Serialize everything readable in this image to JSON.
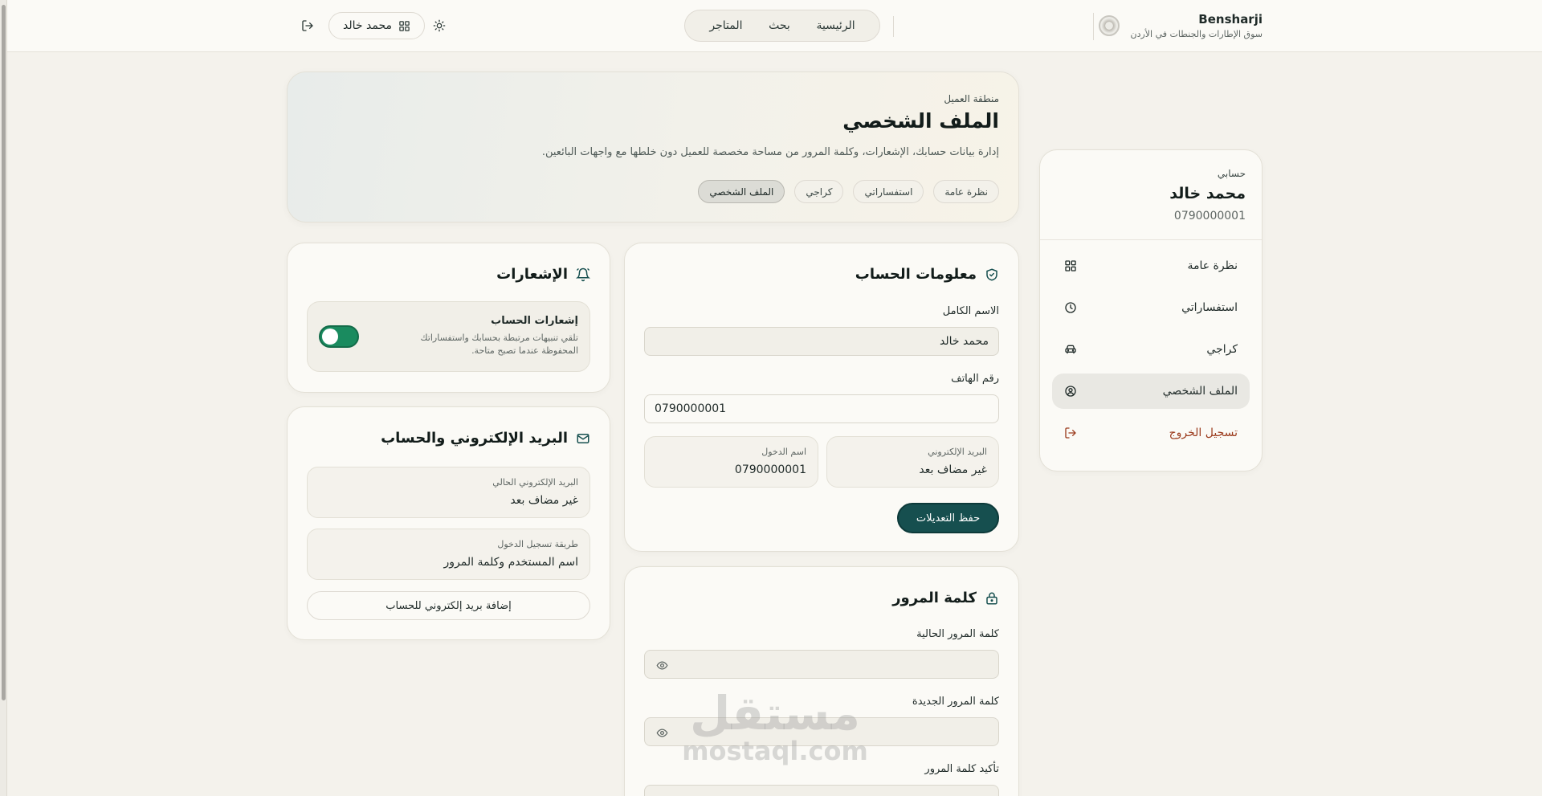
{
  "brand": {
    "name": "Bensharji",
    "tagline": "سوق الإطارات والجنطات في الأردن"
  },
  "nav": {
    "items": [
      "الرئيسية",
      "بحث",
      "المتاجر"
    ]
  },
  "header": {
    "user_name": "محمد خالد",
    "theme_icon": "sun-icon",
    "logout_icon": "logout-icon"
  },
  "hero": {
    "eyebrow": "منطقة العميل",
    "title": "الملف الشخصي",
    "description": "إدارة بيانات حسابك، الإشعارات، وكلمة المرور من مساحة مخصصة للعميل دون خلطها مع واجهات البائعين.",
    "tabs": [
      "نظرة عامة",
      "استفساراتي",
      "كراجي",
      "الملف الشخصي"
    ],
    "active_tab": "الملف الشخصي"
  },
  "sidebar": {
    "label": "حسابي",
    "name": "محمد خالد",
    "phone": "0790000001",
    "items": [
      {
        "label": "نظرة عامة",
        "icon": "grid-icon"
      },
      {
        "label": "استفساراتي",
        "icon": "clock-icon"
      },
      {
        "label": "كراجي",
        "icon": "car-icon"
      },
      {
        "label": "الملف الشخصي",
        "icon": "user-circle-icon"
      },
      {
        "label": "تسجيل الخروج",
        "icon": "logout-icon"
      }
    ]
  },
  "account": {
    "title": "معلومات الحساب",
    "full_name_label": "الاسم الكامل",
    "full_name_value": "محمد خالد",
    "phone_label": "رقم الهاتف",
    "phone_value": "0790000001",
    "email_label": "البريد الإلكتروني",
    "email_value": "غير مضاف بعد",
    "username_label": "اسم الدخول",
    "username_value": "0790000001",
    "save_label": "حفظ التعديلات"
  },
  "password": {
    "title": "كلمة المرور",
    "current_label": "كلمة المرور الحالية",
    "new_label": "كلمة المرور الجديدة",
    "confirm_label": "تأكيد كلمة المرور"
  },
  "notifications": {
    "title": "الإشعارات",
    "toggle_title": "إشعارات الحساب",
    "toggle_desc": "تلقي تنبيهات مرتبطة بحسابك واستفساراتك المحفوظة عندما تصبح متاحة.",
    "enabled": true
  },
  "email_account": {
    "title": "البريد الإلكتروني والحساب",
    "current_email_label": "البريد الإلكتروني الحالي",
    "current_email_value": "غير مضاف بعد",
    "login_method_label": "طريقة تسجيل الدخول",
    "login_method_value": "اسم المستخدم وكلمة المرور",
    "add_email_label": "إضافة بريد إلكتروني للحساب"
  },
  "watermark": {
    "arabic": "مستقل",
    "latin": "mostaql.com"
  },
  "colors": {
    "primary": "#164f4f",
    "toggle_on": "#1a8b5f",
    "logout": "#9b3b1d",
    "background": "#f4f2ec"
  }
}
